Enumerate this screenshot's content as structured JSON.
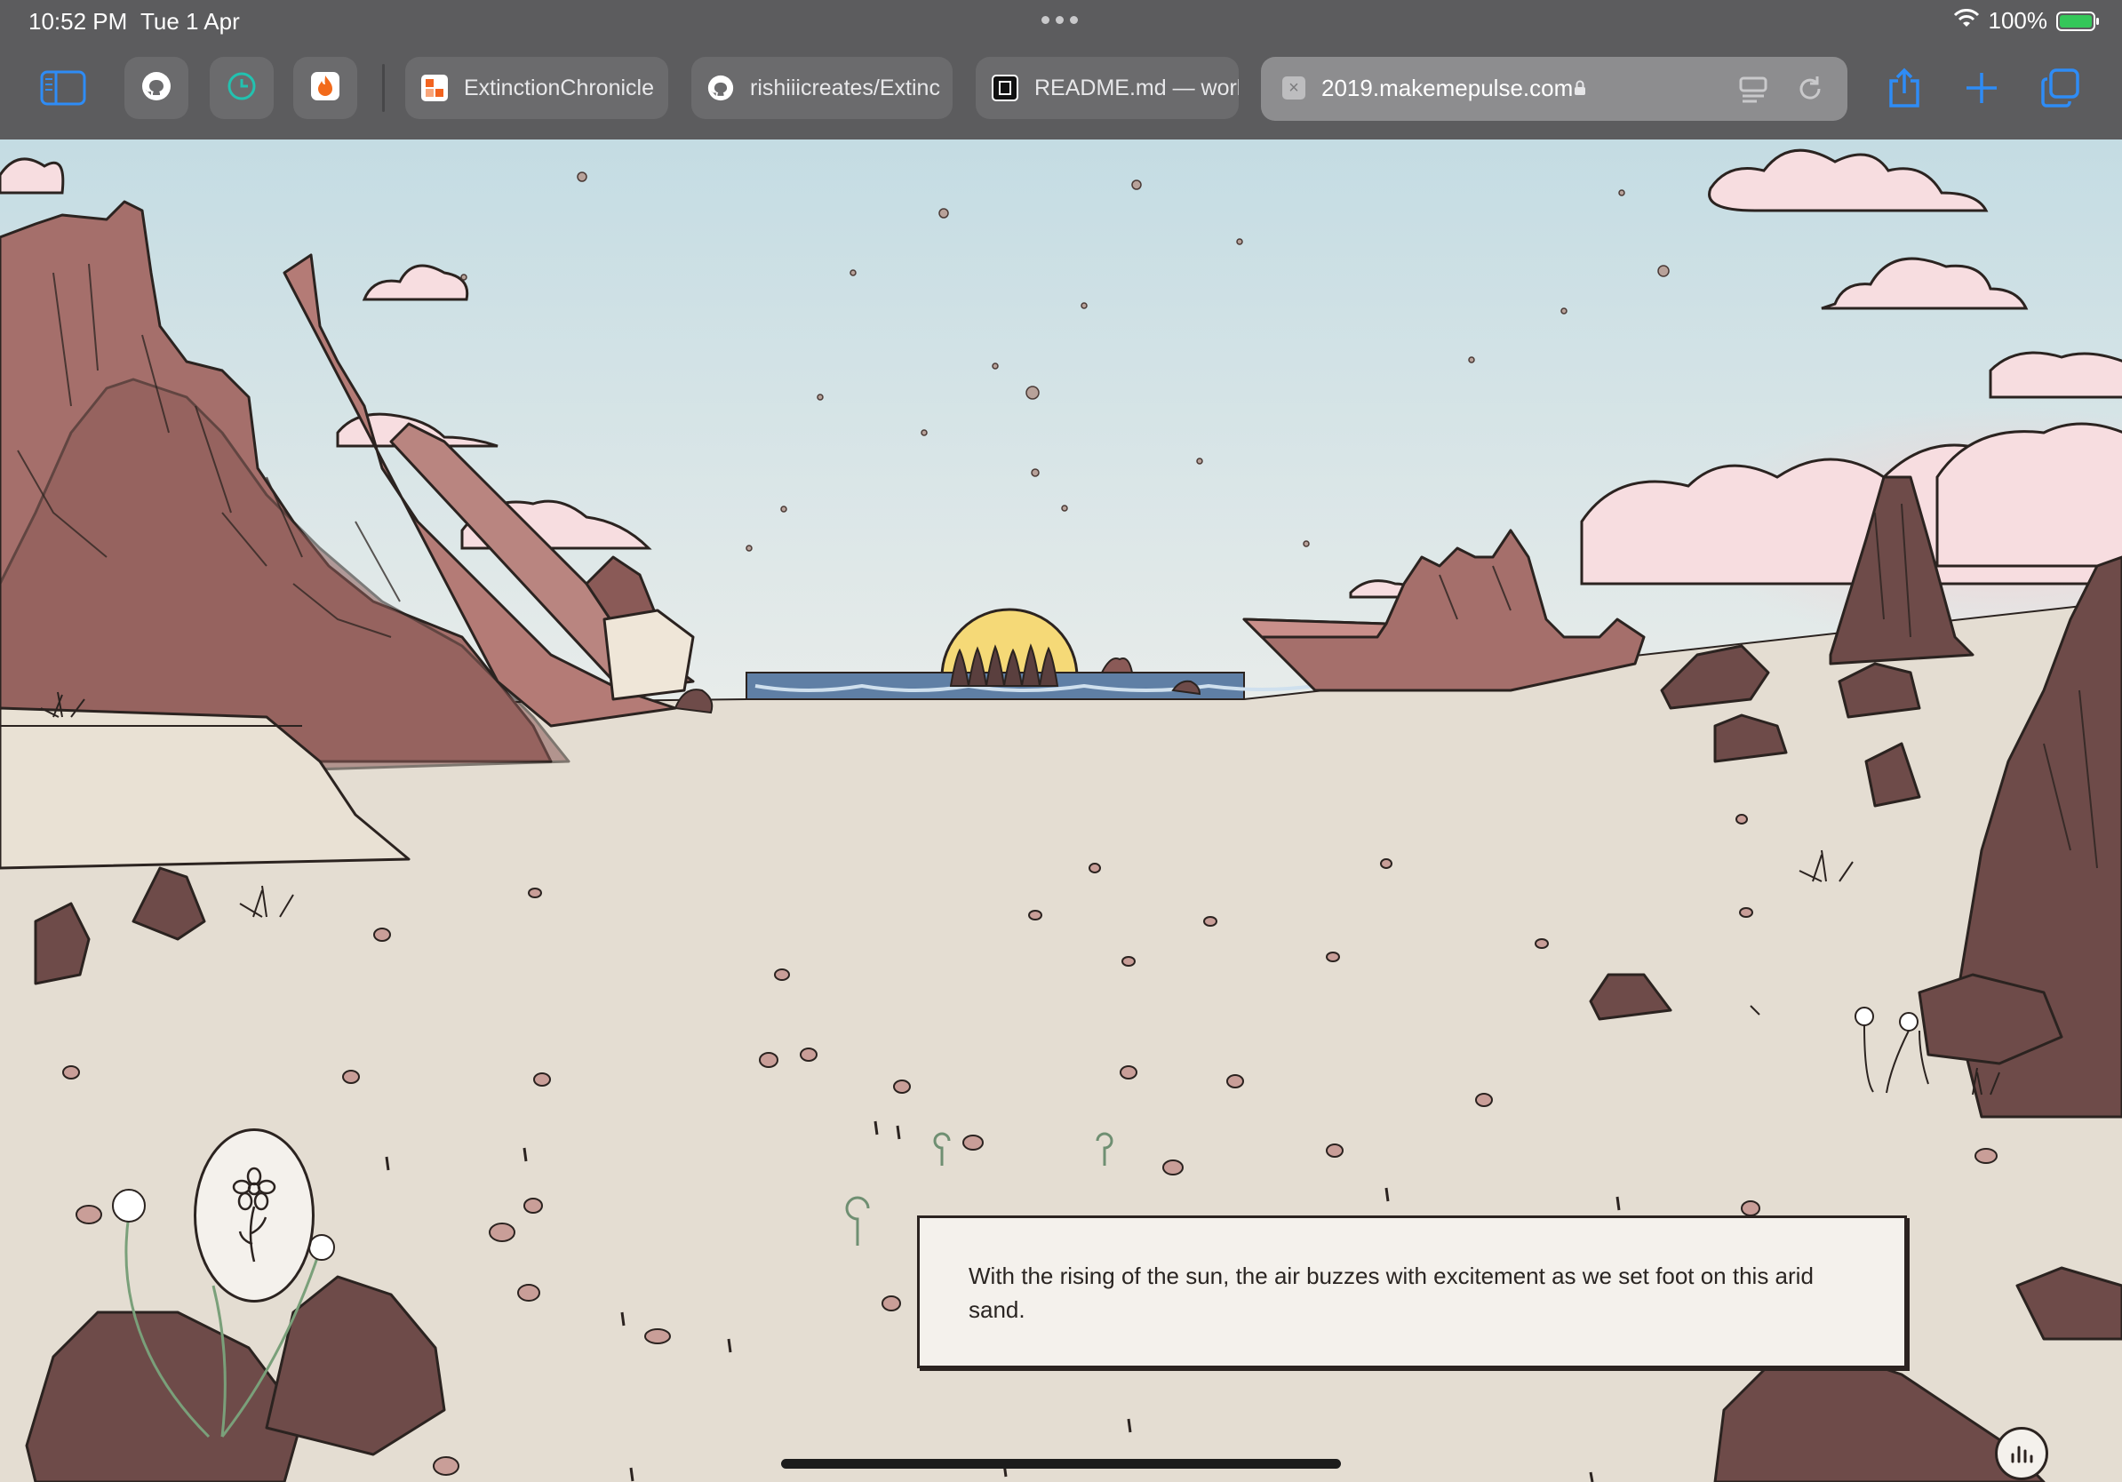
{
  "status_bar": {
    "time": "10:52 PM",
    "date": "Tue 1 Apr",
    "battery": "100%"
  },
  "toolbar": {
    "icons": [
      "sidebar-icon",
      "github-icon",
      "clock-icon",
      "flame-icon"
    ],
    "tabs": [
      {
        "label": "ExtinctionChronicle",
        "icon": "extinction-favicon"
      },
      {
        "label": "rishiiicreates/Extinc",
        "icon": "github-icon"
      },
      {
        "label": "README.md — worl",
        "icon": "notion-favicon"
      }
    ],
    "url": "2019.makemepulse.com",
    "actions": [
      "share-icon",
      "new-tab-icon",
      "tabs-overview-icon"
    ]
  },
  "scene": {
    "narration": "With the rising of the sun, the air buzzes with excitement as we set foot on this arid sand."
  },
  "colors": {
    "chrome": "#5c5c5e",
    "accent": "#0a84ff",
    "sky_top": "#cfe3e8",
    "sand": "#e4ddd2",
    "rock": "#9a6a66",
    "dark_rock": "#6e4b49",
    "sun": "#f5d977",
    "sea": "#5f7fa5",
    "cloud": "#f4d6da"
  }
}
